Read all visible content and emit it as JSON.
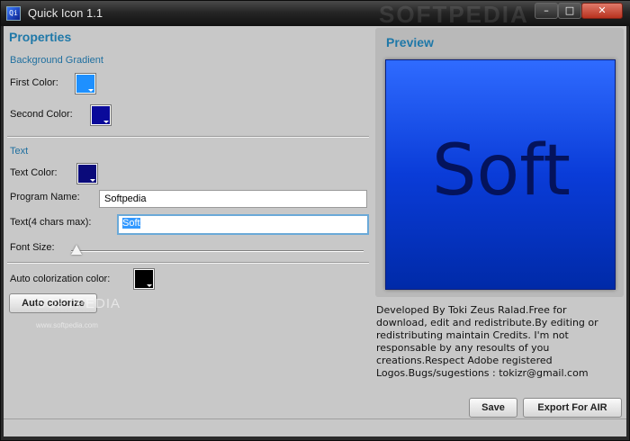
{
  "window": {
    "title": "Quick Icon 1.1",
    "watermark": "SOFTPEDIA",
    "controls": {
      "minimize": "–",
      "maximize": "□",
      "close": "✕"
    }
  },
  "properties": {
    "heading": "Properties",
    "background_gradient": {
      "section_label": "Background Gradient",
      "first_color_label": "First Color:",
      "first_color": "#1e90ff",
      "second_color_label": "Second Color:",
      "second_color": "#0a0a9a"
    },
    "text": {
      "section_label": "Text",
      "text_color_label": "Text Color:",
      "text_color": "#0a0a7a",
      "program_name_label": "Program Name:",
      "program_name_value": "Softpedia",
      "text_label": "Text(4 chars max):",
      "text_value": "Soft",
      "font_size_label": "Font Size:",
      "font_size_value": 0
    },
    "auto": {
      "label": "Auto colorization color:",
      "color": "#000000",
      "button": "Auto colorize"
    },
    "watermark": "SOFTPEDIA",
    "watermark_url": "www.softpedia.com"
  },
  "preview": {
    "heading": "Preview",
    "icon_text": "Soft",
    "credits": "Developed By Toki Zeus Ralad.Free for download, edit and redistribute.By editing or redistributing maintain Credits. I'm not responsable by any resoults of you creations.Respect Adobe registered Logos.Bugs/sugestions : tokizr@gmail.com"
  },
  "actions": {
    "save": "Save",
    "export": "Export For AIR"
  },
  "colors": {
    "accent": "#1f78a8",
    "panel_bg": "#c8c8c8"
  }
}
